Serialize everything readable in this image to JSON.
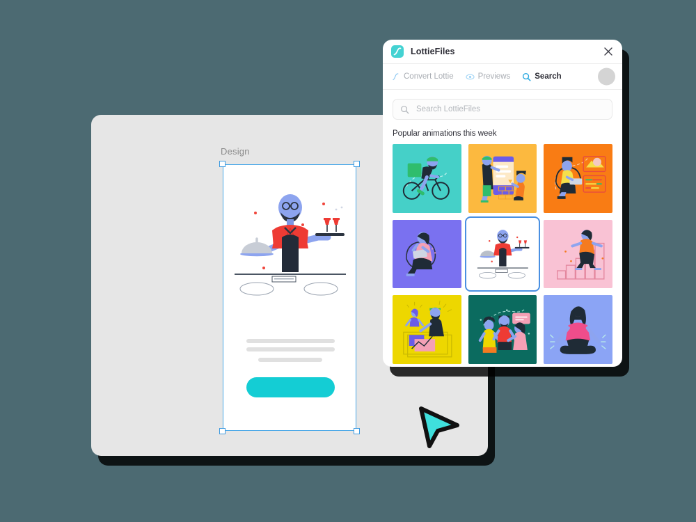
{
  "background_color": "#4c6a72",
  "canvas_window": {
    "name": "design-canvas",
    "background_color": "#e6e6e6",
    "layer_label": "Design",
    "artboard": {
      "background_color": "#ffffff",
      "selected": true,
      "selection_color": "#4aa8e8",
      "cta_button_color": "#14cdd4",
      "placeholder_line_color": "#e0e0e0",
      "artwork": "waiter-illustration"
    },
    "cursor": {
      "icon": "arrow-cursor-icon",
      "fill_color": "#3fe0dd",
      "stroke_color": "#111111"
    }
  },
  "plugin_panel": {
    "logo_icon": "lottiefiles-logo-icon",
    "logo_color": "#44d2d2",
    "title": "LottieFiles",
    "close_icon": "close-icon",
    "tabs": [
      {
        "label": "Convert Lottie",
        "icon": "convert-lottie-icon",
        "active": false
      },
      {
        "label": "Previews",
        "icon": "eye-icon",
        "active": false
      },
      {
        "label": "Search",
        "icon": "search-icon",
        "active": true
      }
    ],
    "avatar": {
      "icon": "avatar",
      "color": "#d4d4d4"
    },
    "search": {
      "icon": "search-icon",
      "value": "",
      "placeholder": "Search LottieFiles"
    },
    "section_title": "Popular animations this week",
    "thumbnails": [
      {
        "name": "delivery-cyclist-animation",
        "bg": "#45d0c8",
        "selected": false
      },
      {
        "name": "chat-app-animation",
        "bg": "#fcb93f",
        "selected": false
      },
      {
        "name": "coding-workspace-animation",
        "bg": "#f97c14",
        "selected": false
      },
      {
        "name": "remote-work-animation",
        "bg": "#7a71f0",
        "selected": false
      },
      {
        "name": "waiter-serving-animation",
        "bg": "#ffffff",
        "selected": true
      },
      {
        "name": "growth-steps-animation",
        "bg": "#f9c2d4",
        "selected": false
      },
      {
        "name": "data-analytics-animation",
        "bg": "#edd700",
        "selected": false
      },
      {
        "name": "team-meeting-animation",
        "bg": "#0b6b5f",
        "selected": false
      },
      {
        "name": "meditation-animation",
        "bg": "#8ba4f5",
        "selected": false
      }
    ]
  }
}
